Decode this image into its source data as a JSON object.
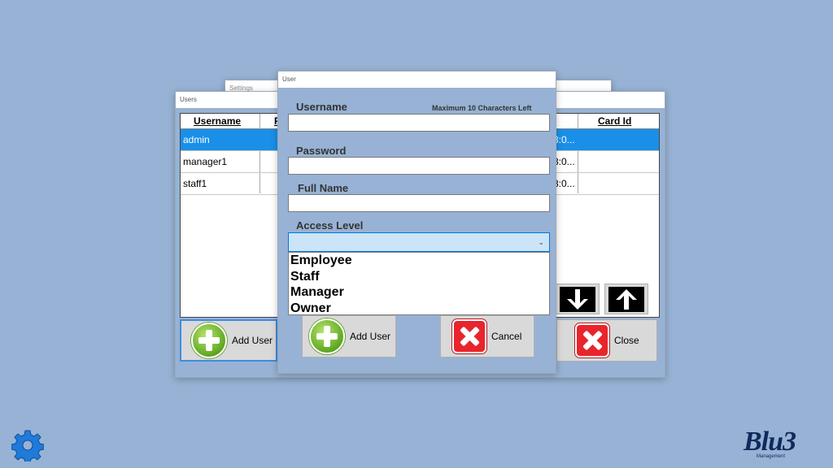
{
  "settings_window": {
    "title": "Settings"
  },
  "users_window": {
    "title": "Users",
    "columns": [
      "Username",
      "F",
      "",
      "Card Id"
    ],
    "rows": [
      {
        "username": "admin",
        "partial": "3:0...",
        "selected": true
      },
      {
        "username": "manager1",
        "partial": "3:0...",
        "selected": false
      },
      {
        "username": "staff1",
        "partial": "3:0...",
        "selected": false
      }
    ],
    "add_user_label": "Add User",
    "close_label": "Close"
  },
  "user_dialog": {
    "title": "User",
    "username_label": "Username",
    "username_hint": "Maximum 10 Characters Left",
    "username_value": "",
    "password_label": "Password",
    "password_value": "",
    "fullname_label": "Full Name",
    "fullname_value": "",
    "access_label": "Access Level",
    "access_selected": "",
    "access_options": [
      "Employee",
      "Staff",
      "Manager",
      "Owner"
    ],
    "add_user_label": "Add User",
    "cancel_label": "Cancel"
  },
  "logo": {
    "text": "Blu3",
    "sub": "Management"
  },
  "colors": {
    "background": "#97b2d4",
    "selected_row": "#1a8fe8",
    "dropdown_focus": "#cce4f7"
  }
}
